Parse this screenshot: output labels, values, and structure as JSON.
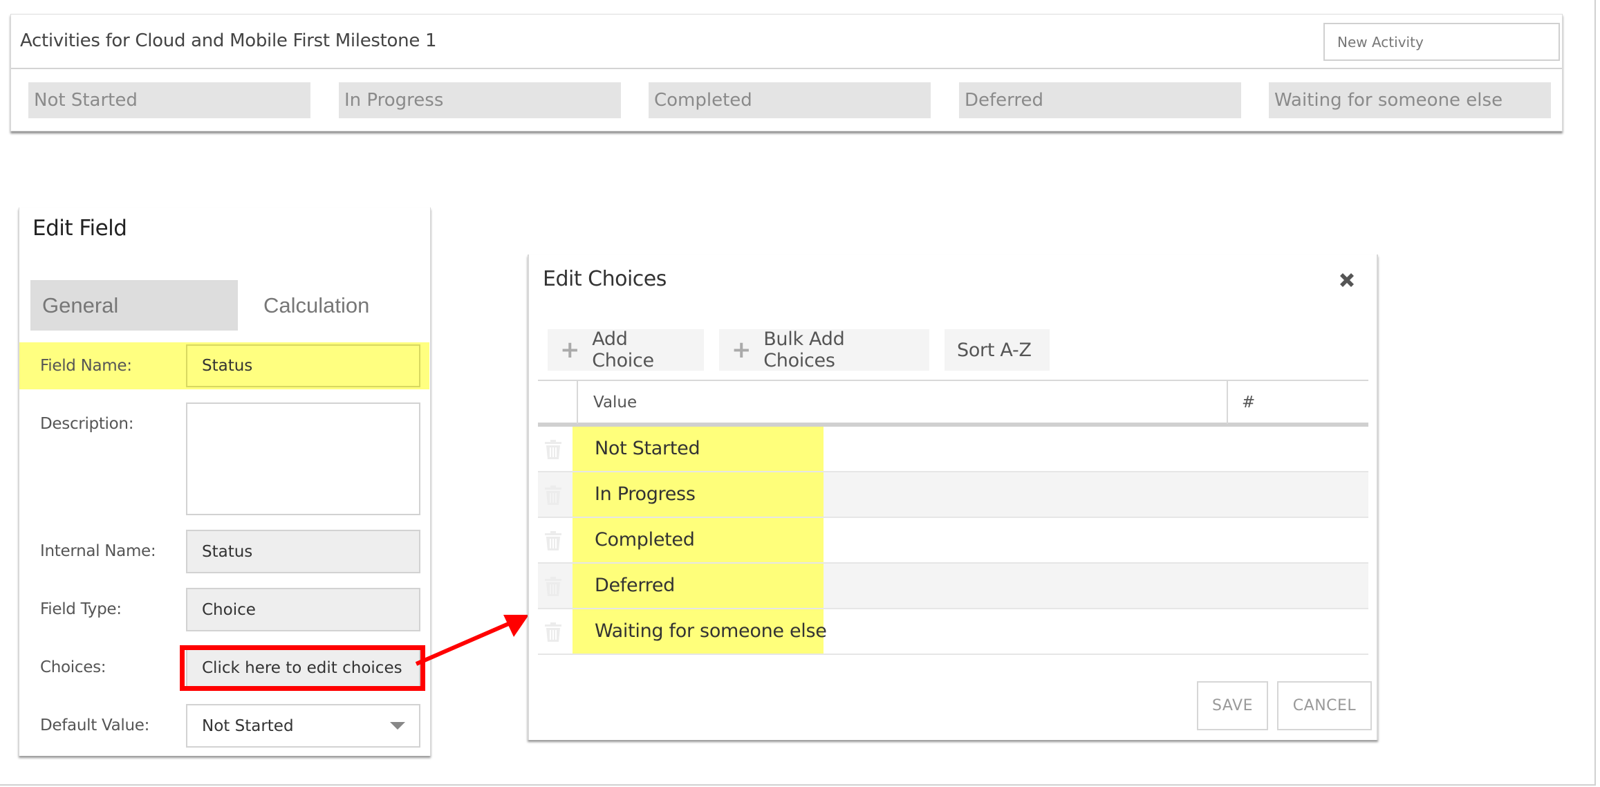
{
  "activities_panel": {
    "title": "Activities for Cloud and Mobile First Milestone 1",
    "new_activity_placeholder": "New Activity",
    "status_columns": [
      "Not Started",
      "In Progress",
      "Completed",
      "Deferred",
      "Waiting for someone else"
    ]
  },
  "edit_field": {
    "title": "Edit Field",
    "tabs": [
      {
        "label": "General",
        "active": true
      },
      {
        "label": "Calculation",
        "active": false
      }
    ],
    "fields": {
      "field_name": {
        "label": "Field Name:",
        "value": "Status"
      },
      "description": {
        "label": "Description:",
        "value": ""
      },
      "internal_name": {
        "label": "Internal Name:",
        "value": "Status"
      },
      "field_type": {
        "label": "Field Type:",
        "value": "Choice"
      },
      "choices": {
        "label": "Choices:",
        "value": "Click here to edit choices"
      },
      "default_value": {
        "label": "Default Value:",
        "value": "Not Started"
      }
    }
  },
  "edit_choices": {
    "title": "Edit Choices",
    "toolbar": {
      "add_choice": "Add Choice",
      "bulk_add": "Bulk Add Choices",
      "sort": "Sort A-Z"
    },
    "columns": {
      "value": "Value",
      "number": "#"
    },
    "rows": [
      "Not Started",
      "In Progress",
      "Completed",
      "Deferred",
      "Waiting for someone else"
    ],
    "save_label": "SAVE",
    "cancel_label": "CANCEL"
  },
  "annotations": {
    "highlight_color": "#ffff80",
    "callout_color": "#ff0000"
  }
}
